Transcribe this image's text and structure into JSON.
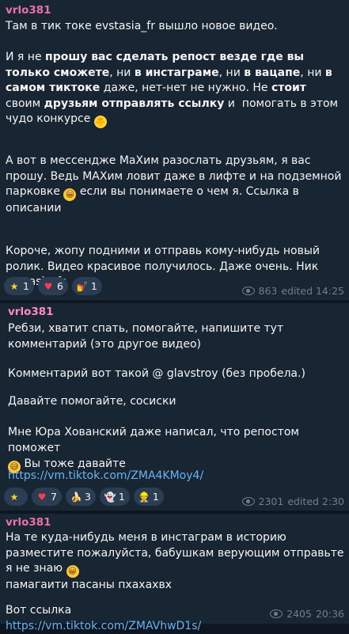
{
  "messages": [
    {
      "author": "vrlo381",
      "p1": "Там в тик токе evstasia_fr вышло новое видео.",
      "p2a": "И я не ",
      "p2b": "прошу вас сделать репост везде где вы только сможете",
      "p2c": ", ни ",
      "p2d": "в инстаграме",
      "p2e": ", ни ",
      "p2f": "в вацапе",
      "p2g": ", ни ",
      "p2h": "в самом тиктоке",
      "p2i": " даже, нет-нет не нужно. Не ",
      "p2j": "стоит",
      "p2k": " своим ",
      "p2l": "друзьям отправлять ссылку",
      "p2m": " и  помогать в этом чудо конкурсе",
      "p3a": "А вот в мессендже МаХим разослать друзьям, я вас прошу. Ведь МАХим ловит даже в лифте и на подземной парковке",
      "p3b": " если вы понимаете о чем я. Ссылка в описании",
      "p4": "Короче, жопу подними и отправь кому-нибудь новый ролик. Видео красивое получилось. Даже очень. Ник evstasia_fr",
      "reactions": [
        {
          "icon": "★",
          "count": "1"
        },
        {
          "icon": "♥",
          "count": "6"
        },
        {
          "icon": "💅",
          "count": "1"
        }
      ],
      "views": "863",
      "edited": "edited 14:25"
    },
    {
      "author": "vrlo381",
      "l1": "Ребзи, хватит спать, помогайте, напишите тут комментарий (это другое видео)",
      "l2": "Комментарий вот такой @ glavstroy (без пробела.)",
      "l3": "Давайте помогайте, сосиски",
      "l4a": "Мне Юра Хованский даже написал, что репостом поможет",
      "l4b": " Вы тоже давайте",
      "link": "https://vm.tiktok.com/ZMA4KMoy4/",
      "reactions": [
        {
          "icon": "★",
          "count": ""
        },
        {
          "icon": "♥",
          "count": "7"
        },
        {
          "icon": "🍌",
          "count": "3"
        },
        {
          "icon": "👻",
          "count": "1"
        },
        {
          "icon": "👷",
          "count": "1"
        }
      ],
      "views": "2301",
      "edited": "edited 2:30"
    },
    {
      "author": "vrlo381",
      "t1": "На те куда-нибудь меня в инстаграм в историю разместите пожалуйста, бабушкам верующим отправьте я не знаю",
      "t2": "памагаити пасаны пхахахвх",
      "t3": "Вот ссылка ",
      "link": "https://vm.tiktok.com/ZMAVhwD1s/",
      "views": "2405",
      "time": "20:36"
    }
  ],
  "colors": {
    "background": "#0e1621",
    "bubble": "#182533",
    "author": "#e872a8",
    "link": "#6ab3f3",
    "meta": "#6d7f8f"
  }
}
